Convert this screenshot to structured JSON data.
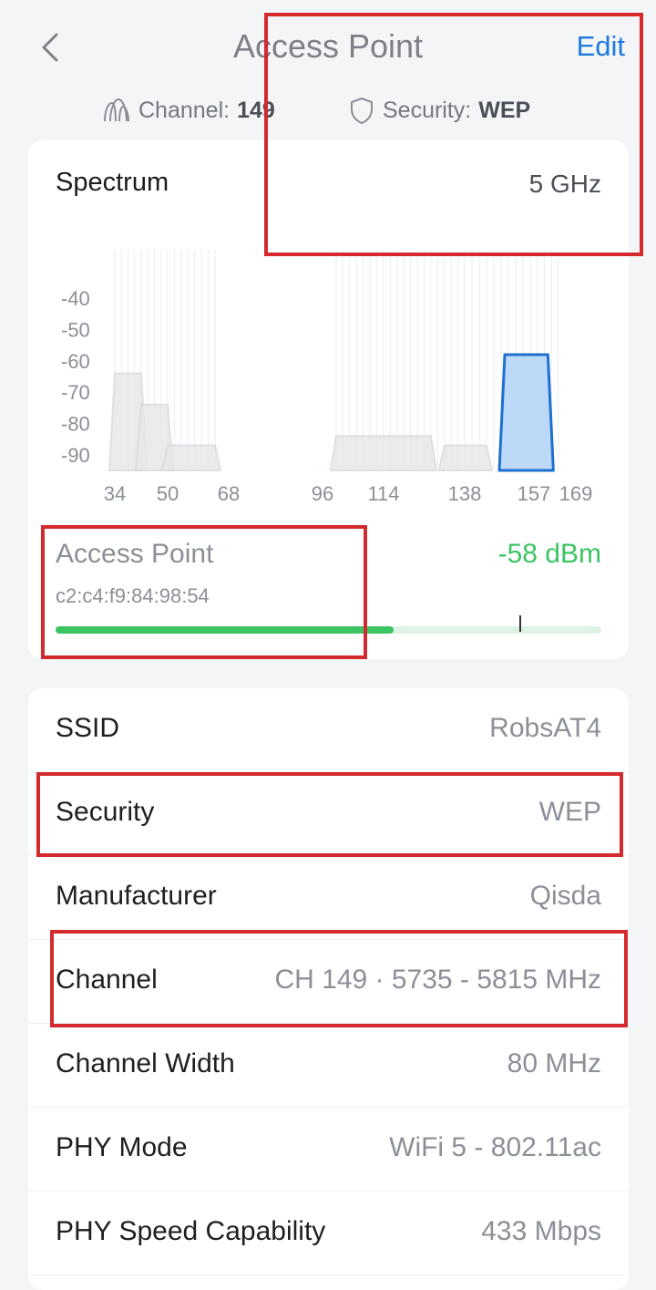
{
  "header": {
    "title": "Access Point",
    "edit_label": "Edit",
    "channel_label": "Channel:",
    "channel_value": "149",
    "security_label": "Security:",
    "security_value": "WEP"
  },
  "spectrum": {
    "title": "Spectrum",
    "band": "5 GHz"
  },
  "chart_data": {
    "type": "area",
    "title": "",
    "xlabel": "",
    "ylabel": "",
    "x_ticks": [
      "34",
      "50",
      "68",
      "96",
      "114",
      "138",
      "157",
      "169"
    ],
    "y_ticks": [
      "-40",
      "-50",
      "-60",
      "-70",
      "-80",
      "-90"
    ],
    "ylim": [
      -95,
      -35
    ],
    "series": [
      {
        "channel_start": 34,
        "channel_end": 42,
        "level": -64,
        "highlight": false
      },
      {
        "channel_start": 42,
        "channel_end": 50,
        "level": -74,
        "highlight": false
      },
      {
        "channel_start": 50,
        "channel_end": 64,
        "level": -87,
        "highlight": false
      },
      {
        "channel_start": 100,
        "channel_end": 128,
        "level": -84,
        "highlight": false
      },
      {
        "channel_start": 132,
        "channel_end": 144,
        "level": -87,
        "highlight": false
      },
      {
        "channel_start": 149,
        "channel_end": 161,
        "level": -58,
        "highlight": true
      }
    ]
  },
  "access_point": {
    "label": "Access Point",
    "mac": "c2:c4:f9:84:98:54",
    "signal": "-58 dBm",
    "signal_fill_percent": 62,
    "marker_percent": 85
  },
  "details": [
    {
      "label": "SSID",
      "value": "RobsAT4"
    },
    {
      "label": "Security",
      "value": "WEP"
    },
    {
      "label": "Manufacturer",
      "value": "Qisda"
    },
    {
      "label": "Channel",
      "value": "CH 149 · 5735 - 5815 MHz"
    },
    {
      "label": "Channel Width",
      "value": "80 MHz"
    },
    {
      "label": "PHY Mode",
      "value": "WiFi 5 - 802.11ac"
    },
    {
      "label": "PHY Speed Capability",
      "value": "433 Mbps"
    }
  ],
  "colors": {
    "accent": "#1f7ae0",
    "signal_green": "#3cc463",
    "highlight_red": "#d42a2e"
  }
}
